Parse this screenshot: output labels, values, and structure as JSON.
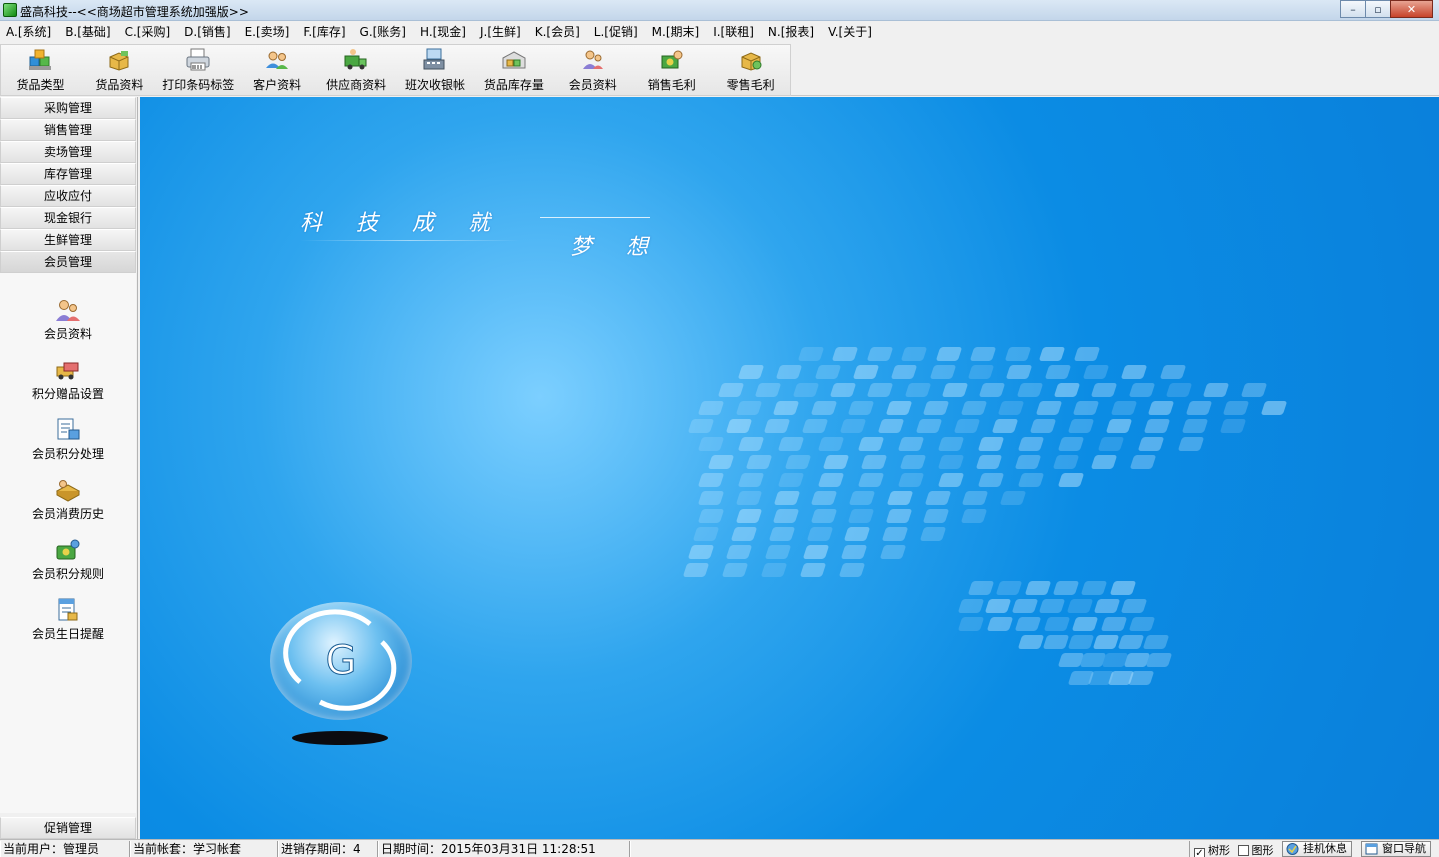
{
  "window": {
    "title": "盛高科技--<<商场超市管理系统加强版>>",
    "minimize": "–",
    "maximize": "▫",
    "close": "✕"
  },
  "menu": [
    {
      "label": "A.[系统]"
    },
    {
      "label": "B.[基础]"
    },
    {
      "label": "C.[采购]"
    },
    {
      "label": "D.[销售]"
    },
    {
      "label": "E.[卖场]"
    },
    {
      "label": "F.[库存]"
    },
    {
      "label": "G.[账务]"
    },
    {
      "label": "H.[现金]"
    },
    {
      "label": "J.[生鲜]"
    },
    {
      "label": "K.[会员]"
    },
    {
      "label": "L.[促销]"
    },
    {
      "label": "M.[期末]"
    },
    {
      "label": "I.[联租]"
    },
    {
      "label": "N.[报表]"
    },
    {
      "label": "V.[关于]"
    }
  ],
  "toolbar": [
    {
      "label": "货品类型",
      "icon": "product-type-icon"
    },
    {
      "label": "货品资料",
      "icon": "product-info-icon"
    },
    {
      "label": "打印条码标签",
      "icon": "barcode-printer-icon"
    },
    {
      "label": "客户资料",
      "icon": "customer-icon"
    },
    {
      "label": "供应商资料",
      "icon": "supplier-icon"
    },
    {
      "label": "班次收银帐",
      "icon": "cashier-shift-icon"
    },
    {
      "label": "货品库存量",
      "icon": "inventory-icon"
    },
    {
      "label": "会员资料",
      "icon": "member-icon"
    },
    {
      "label": "销售毛利",
      "icon": "sales-profit-icon"
    },
    {
      "label": "零售毛利",
      "icon": "retail-profit-icon"
    }
  ],
  "sidebar": {
    "groups": [
      {
        "label": "采购管理"
      },
      {
        "label": "销售管理"
      },
      {
        "label": "卖场管理"
      },
      {
        "label": "库存管理"
      },
      {
        "label": "应收应付"
      },
      {
        "label": "现金银行"
      },
      {
        "label": "生鲜管理"
      },
      {
        "label": "会员管理"
      }
    ],
    "active_group": "会员管理",
    "items": [
      {
        "label": "会员资料",
        "icon": "member-info-icon"
      },
      {
        "label": "积分赠品设置",
        "icon": "points-gift-icon"
      },
      {
        "label": "会员积分处理",
        "icon": "points-process-icon"
      },
      {
        "label": "会员消费历史",
        "icon": "consumption-history-icon"
      },
      {
        "label": "会员积分规则",
        "icon": "points-rule-icon"
      },
      {
        "label": "会员生日提醒",
        "icon": "birthday-reminder-icon"
      }
    ],
    "bottom_group": "促销管理"
  },
  "banner": {
    "slogan_left": "科技成就",
    "slogan_right": "梦想"
  },
  "status": {
    "user": "当前用户：管理员",
    "account": "当前帐套：学习帐套",
    "period": "进销存期间：4",
    "datetime": "日期时间：2015年03月31日 11:28:51",
    "tree_label": "树形",
    "graph_label": "图形",
    "lock_label": "挂机休息",
    "nav_label": "窗口导航"
  }
}
